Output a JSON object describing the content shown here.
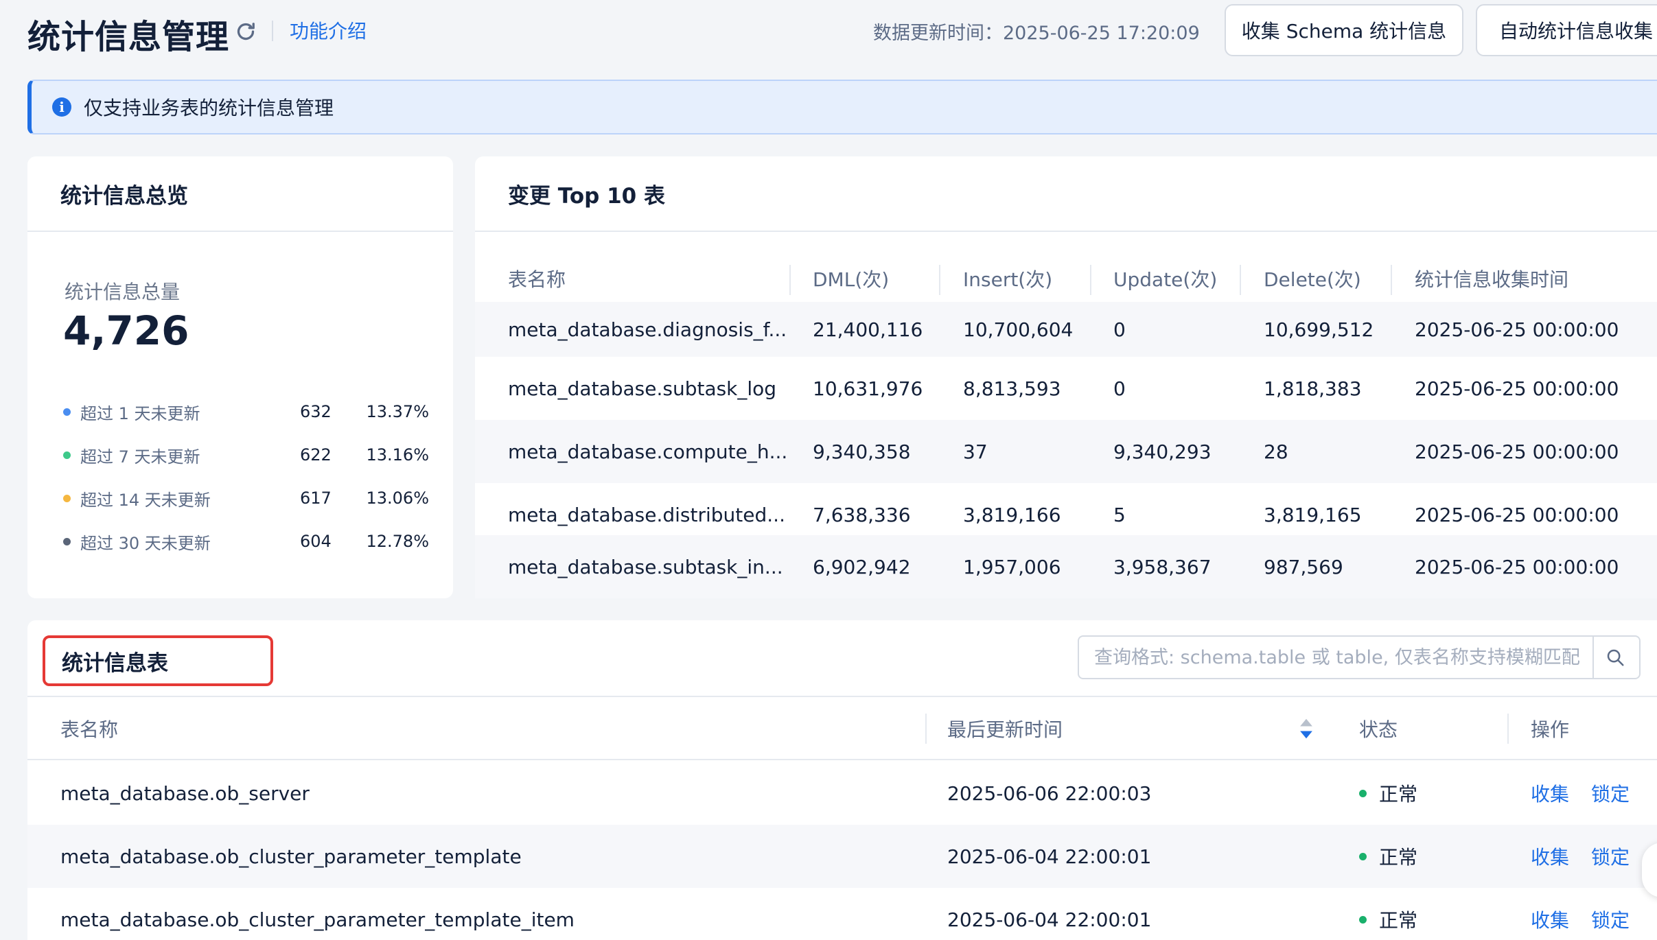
{
  "header": {
    "title": "统计信息管理",
    "intro_link": "功能介绍",
    "update_time": "数据更新时间：2025-06-25 17:20:09",
    "btn_collect_schema": "收集 Schema 统计信息",
    "btn_auto_collect": "自动统计信息收集",
    "refresh_icon": "refresh-icon"
  },
  "alert": {
    "text": "仅支持业务表的统计信息管理",
    "icon": "info-icon"
  },
  "overview": {
    "title": "统计信息总览",
    "total_label": "统计信息总量",
    "total_value": "4,726",
    "rows": [
      {
        "label": "超过 1 天未更新",
        "count": "632",
        "pct": "13.37%",
        "color": "#4a8df0"
      },
      {
        "label": "超过 7 天未更新",
        "count": "622",
        "pct": "13.16%",
        "color": "#3ec98a"
      },
      {
        "label": "超过 14 天未更新",
        "count": "617",
        "pct": "13.06%",
        "color": "#f5b740"
      },
      {
        "label": "超过 30 天未更新",
        "count": "604",
        "pct": "12.78%",
        "color": "#5a6578"
      }
    ]
  },
  "top10": {
    "title": "变更 Top 10 表",
    "columns": [
      "表名称",
      "DML(次)",
      "Insert(次)",
      "Update(次)",
      "Delete(次)",
      "统计信息收集时间"
    ],
    "rows": [
      [
        "meta_database.diagnosis_f...",
        "21,400,116",
        "10,700,604",
        "0",
        "10,699,512",
        "2025-06-25 00:00:00"
      ],
      [
        "meta_database.subtask_log",
        "10,631,976",
        "8,813,593",
        "0",
        "1,818,383",
        "2025-06-25 00:00:00"
      ],
      [
        "meta_database.compute_h...",
        "9,340,358",
        "37",
        "9,340,293",
        "28",
        "2025-06-25 00:00:00"
      ],
      [
        "meta_database.distributed...",
        "7,638,336",
        "3,819,166",
        "5",
        "3,819,165",
        "2025-06-25 00:00:00"
      ],
      [
        "meta_database.subtask_in...",
        "6,902,942",
        "1,957,006",
        "3,958,367",
        "987,569",
        "2025-06-25 00:00:00"
      ]
    ]
  },
  "stat_table": {
    "title": "统计信息表",
    "search_placeholder": "查询格式: schema.table 或 table, 仅表名称支持模糊匹配",
    "columns": [
      "表名称",
      "最后更新时间",
      "状态",
      "操作"
    ],
    "rows": [
      {
        "name": "meta_database.ob_server",
        "time": "2025-06-06 22:00:03",
        "status": "正常",
        "a1": "收集",
        "a2": "锁定"
      },
      {
        "name": "meta_database.ob_cluster_parameter_template",
        "time": "2025-06-04 22:00:01",
        "status": "正常",
        "a1": "收集",
        "a2": "锁定"
      },
      {
        "name": "meta_database.ob_cluster_parameter_template_item",
        "time": "2025-06-04 22:00:01",
        "status": "正常",
        "a1": "收集",
        "a2": "锁定"
      }
    ],
    "status_color": "#19b06b"
  },
  "colors": {
    "accent": "#1f6fe5",
    "highlight_box": "#e53935"
  }
}
